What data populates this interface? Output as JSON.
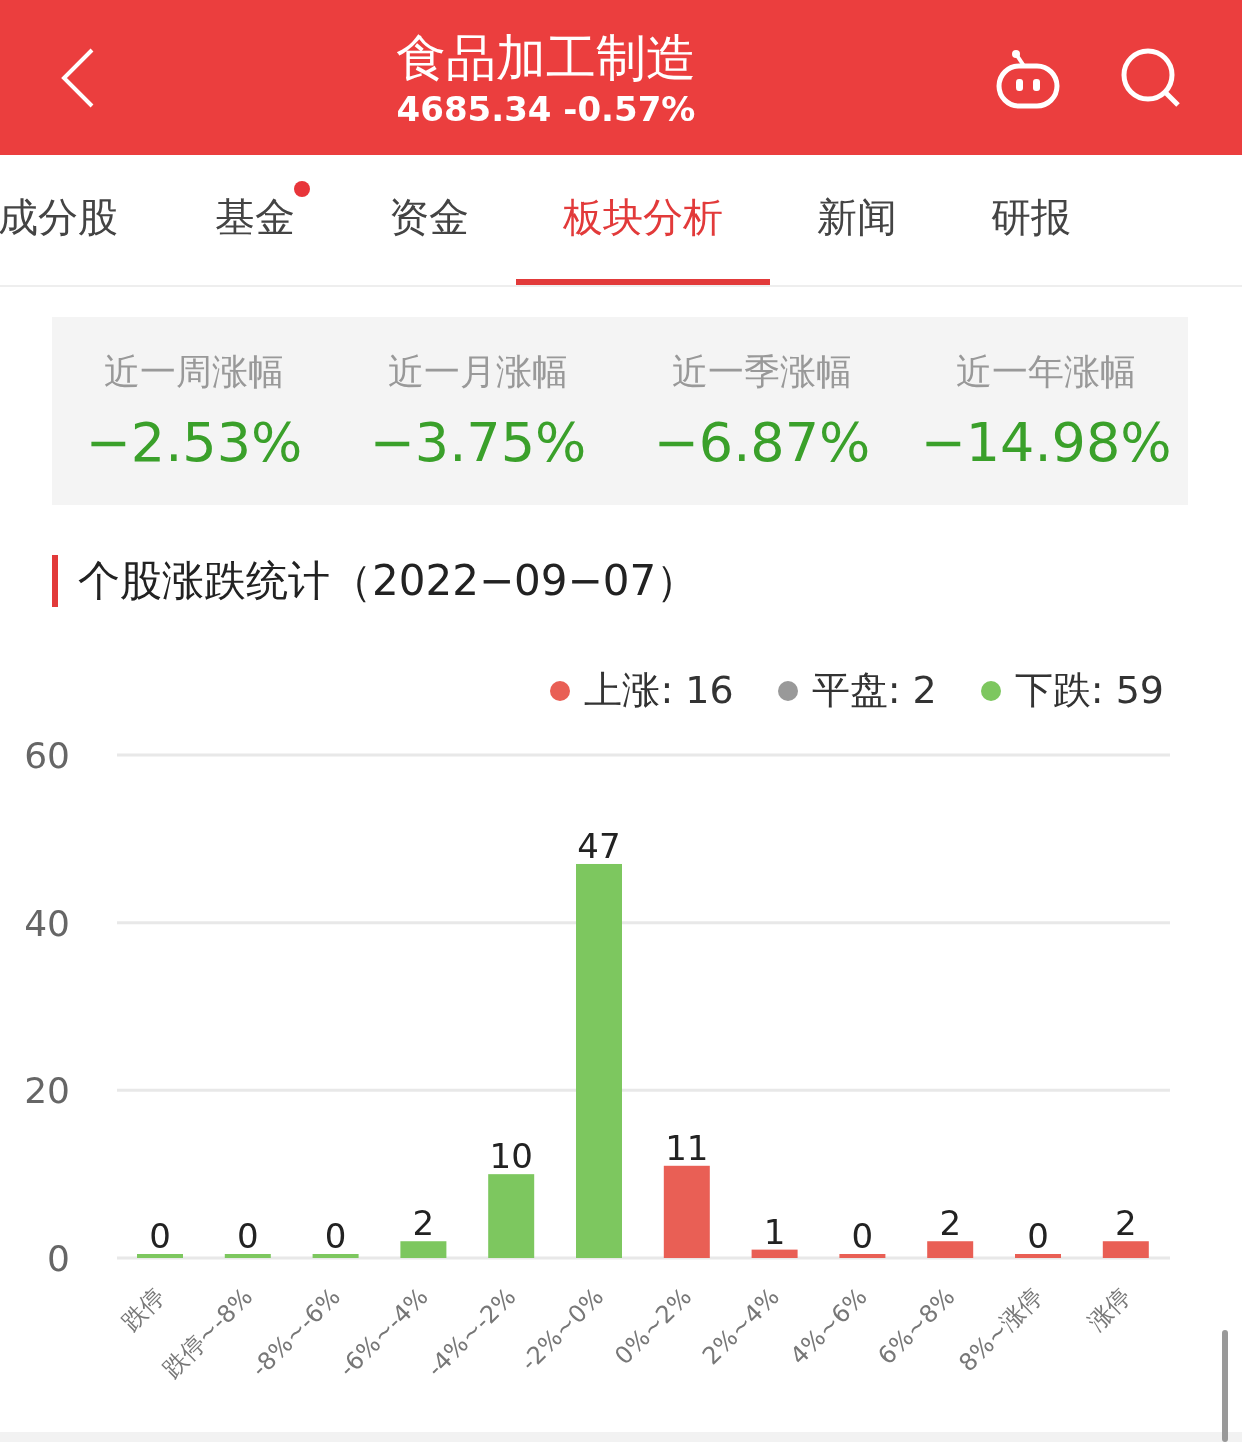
{
  "header": {
    "title": "食品加工制造",
    "quote": "4685.34 -0.57%"
  },
  "tabs": [
    {
      "label": "成分股",
      "selected": false,
      "dot": false
    },
    {
      "label": "基金",
      "selected": false,
      "dot": true
    },
    {
      "label": "资金",
      "selected": false,
      "dot": false
    },
    {
      "label": "板块分析",
      "selected": true,
      "dot": false
    },
    {
      "label": "新闻",
      "selected": false,
      "dot": false
    },
    {
      "label": "研报",
      "selected": false,
      "dot": false
    }
  ],
  "periods": [
    {
      "label": "近一周涨幅",
      "value": "−2.53%"
    },
    {
      "label": "近一月涨幅",
      "value": "−3.75%"
    },
    {
      "label": "近一季涨幅",
      "value": "−6.87%"
    },
    {
      "label": "近一年涨幅",
      "value": "−14.98%"
    }
  ],
  "section_title": "个股涨跌统计（2022−09−07）",
  "legend": [
    {
      "label": "上涨: 16",
      "color": "#e95f55"
    },
    {
      "label": "平盘: 2",
      "color": "#999999"
    },
    {
      "label": "下跌: 59",
      "color": "#7dc75f"
    }
  ],
  "chart": {
    "chart_data": {
      "type": "bar",
      "categories": [
        "跌停",
        "跌停~-8%",
        "-8%~-6%",
        "-6%~-4%",
        "-4%~-2%",
        "-2%~0%",
        "0%~2%",
        "2%~4%",
        "4%~6%",
        "6%~8%",
        "8%~涨停",
        "涨停"
      ],
      "series": [
        {
          "values": [
            0,
            0,
            0,
            2,
            10,
            47,
            11,
            1,
            0,
            2,
            0,
            2
          ]
        }
      ],
      "colors": [
        "#7dc75f",
        "#7dc75f",
        "#7dc75f",
        "#7dc75f",
        "#7dc75f",
        "#7dc75f",
        "#e95f55",
        "#e95f55",
        "#e95f55",
        "#e95f55",
        "#e95f55",
        "#e95f55"
      ],
      "ylim": [
        0,
        60
      ],
      "yticks": [
        0,
        20,
        40,
        60
      ],
      "data_labels": true
    }
  }
}
